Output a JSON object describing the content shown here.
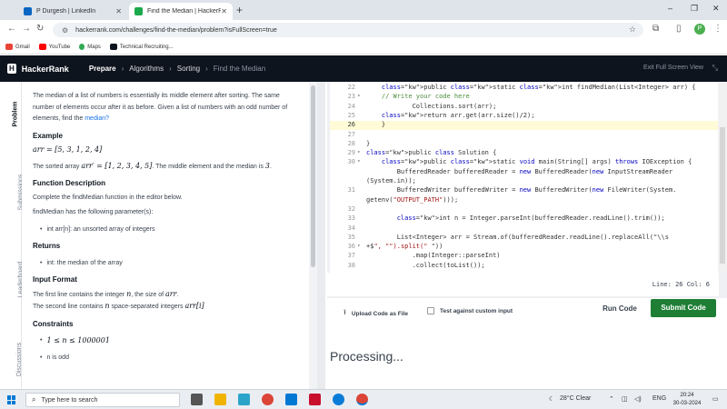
{
  "browser": {
    "tabs": [
      {
        "label": "P Durgesh | LinkedIn",
        "icon": "linkedin-icon"
      },
      {
        "label": "Find the Median | HackerRank",
        "icon": "hackerrank-icon"
      }
    ],
    "url": "hackerrank.com/challenges/find-the-median/problem?isFullScreen=true",
    "profile_initial": "P",
    "bookmarks": [
      {
        "label": "Gmail",
        "color": "#ea4335"
      },
      {
        "label": "YouTube",
        "color": "#ff0000"
      },
      {
        "label": "Maps",
        "color": "#34a853"
      },
      {
        "label": "Technical Recruiting...",
        "color": "#0e141e"
      }
    ]
  },
  "header": {
    "logo": "H",
    "brand": "HackerRank",
    "crumbs": [
      "Prepare",
      "Algorithms",
      "Sorting",
      "Find the Median"
    ],
    "exit_fullscreen": "Exit Full Screen View"
  },
  "rail": [
    "Problem",
    "Submissions",
    "Leaderboard",
    "Discussions"
  ],
  "problem": {
    "intro": "The median of a list of numbers is essentially its middle element after sorting. The same number of elements occur after it as before. Given a list of numbers with an odd number of elements, find the",
    "intro_link": "median?",
    "example_heading": "Example",
    "example_arr": "arr = [5, 3, 1, 2, 4]",
    "sorted_text_a": "The sorted array",
    "sorted_arr": "arr′ = [1, 2, 3, 4, 5]",
    "sorted_text_b": ". The middle element and the median is",
    "median_value": "3",
    "fd_heading": "Function Description",
    "fd_text": "Complete the findMedian function in the editor below.",
    "fd_params": "findMedian has the following parameter(s):",
    "param_item": "int arr[n]: an unsorted array of integers",
    "returns_heading": "Returns",
    "returns_item": "int: the median of the array",
    "input_heading": "Input Format",
    "input_line1_a": "The first line contains the integer",
    "input_line1_var": "n",
    "input_line1_b": ", the size of",
    "input_line1_arr": "arr",
    "input_line2_a": "The second line contains",
    "input_line2_var": "n",
    "input_line2_b": "space-separated integers",
    "input_line2_arr": "arr[i]",
    "constraints_heading": "Constraints",
    "constraint1": "1 ≤ n ≤ 1000001",
    "constraint2": "n is odd"
  },
  "editor": {
    "lines": [
      {
        "n": "22",
        "fold": "",
        "code": "    public static int findMedian(List<Integer> arr) {"
      },
      {
        "n": "23",
        "fold": "v",
        "code": "    // Write your code here"
      },
      {
        "n": "24",
        "fold": "",
        "code": "            Collections.sort(arr);"
      },
      {
        "n": "25",
        "fold": "",
        "code": "    return arr.get(arr.size()/2);"
      },
      {
        "n": "26",
        "fold": "",
        "code": "    }"
      },
      {
        "n": "27",
        "fold": "",
        "code": ""
      },
      {
        "n": "28",
        "fold": "",
        "code": "}"
      },
      {
        "n": "29",
        "fold": "v",
        "code": "public class Solution {"
      },
      {
        "n": "30",
        "fold": "v",
        "code": "    public static void main(String[] args) throws IOException {"
      },
      {
        "n": "",
        "fold": "",
        "code": "        BufferedReader bufferedReader = new BufferedReader(new InputStreamReader"
      },
      {
        "n": "",
        "fold": "",
        "code": "(System.in));"
      },
      {
        "n": "31",
        "fold": "",
        "code": "        BufferedWriter bufferedWriter = new BufferedWriter(new FileWriter(System."
      },
      {
        "n": "",
        "fold": "",
        "code": "getenv(\"OUTPUT_PATH\")));"
      },
      {
        "n": "32",
        "fold": "",
        "code": ""
      },
      {
        "n": "33",
        "fold": "",
        "code": "        int n = Integer.parseInt(bufferedReader.readLine().trim());"
      },
      {
        "n": "34",
        "fold": "",
        "code": ""
      },
      {
        "n": "35",
        "fold": "",
        "code": "        List<Integer> arr = Stream.of(bufferedReader.readLine().replaceAll(\"\\\\s"
      },
      {
        "n": "36",
        "fold": "v",
        "code": "+$\", \"\").split(\" \"))"
      },
      {
        "n": "37",
        "fold": "",
        "code": "            .map(Integer::parseInt)"
      },
      {
        "n": "38",
        "fold": "",
        "code": "            .collect(toList());"
      }
    ],
    "current_line": "26",
    "status": "Line: 26 Col: 6"
  },
  "actions": {
    "upload": "Upload Code as File",
    "custom_input": "Test against custom input",
    "run": "Run Code",
    "submit": "Submit Code"
  },
  "processing": "Processing...",
  "taskbar": {
    "search_placeholder": "Type here to search",
    "weather": "28°C  Clear",
    "lang": "ENG",
    "time": "20:24",
    "date": "30-03-2024"
  }
}
